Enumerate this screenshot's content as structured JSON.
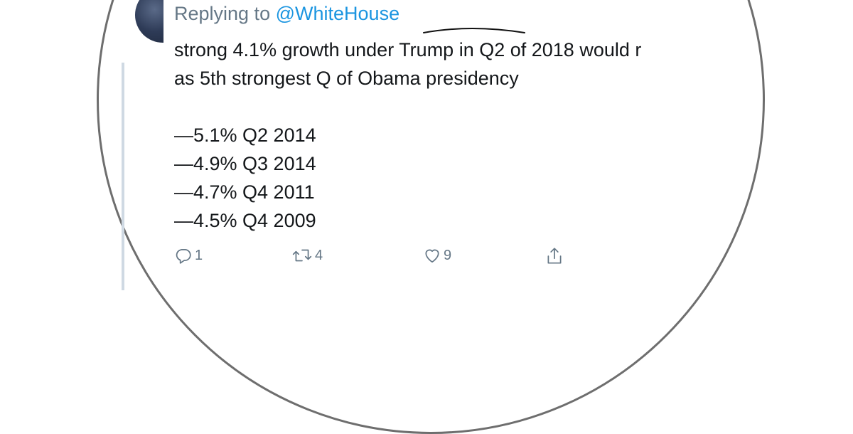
{
  "reply": {
    "prefix": "Replying to",
    "handle": "@WhiteHouse"
  },
  "tweet": {
    "lines": [
      "strong 4.1% growth under Trump in Q2 of 2018 would r",
      "as 5th strongest Q of Obama presidency",
      "—5.1% Q2 2014",
      "—4.9% Q3 2014",
      "—4.7% Q4 2011",
      "—4.5% Q4 2009"
    ]
  },
  "actions": {
    "reply": {
      "icon": "reply-icon",
      "count": "1"
    },
    "retweet": {
      "icon": "retweet-icon",
      "count": "4"
    },
    "like": {
      "icon": "heart-icon",
      "count": "9"
    },
    "share": {
      "icon": "share-icon"
    }
  },
  "colors": {
    "text": "#14171a",
    "secondary": "#657786",
    "link": "#1b95e0",
    "thread_line": "#cfd9e3",
    "circle": "#6e6e6e"
  }
}
